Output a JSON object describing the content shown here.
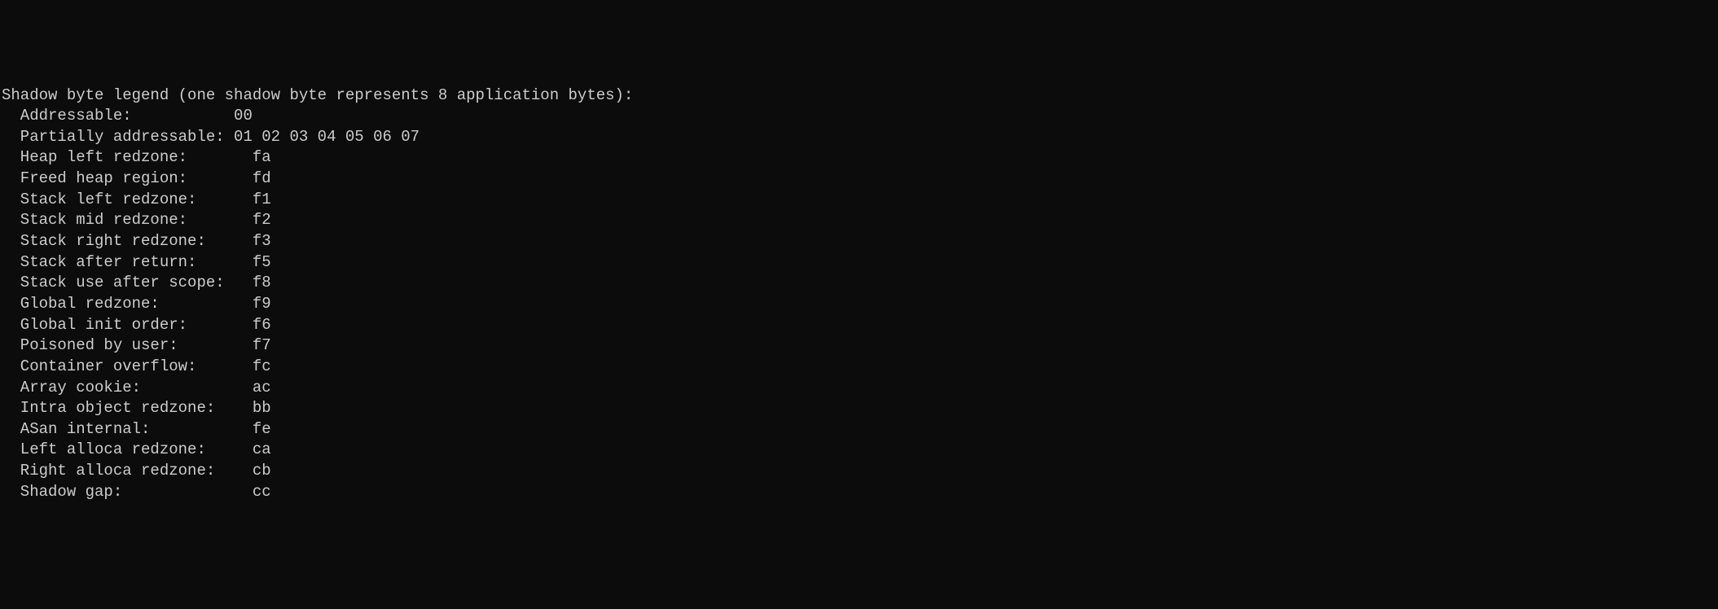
{
  "terminal": {
    "header": "Shadow byte legend (one shadow byte represents 8 application bytes):",
    "entries": [
      {
        "label": "  Addressable:           ",
        "value": "00"
      },
      {
        "label": "  Partially addressable: ",
        "value": "01 02 03 04 05 06 07"
      },
      {
        "label": "  Heap left redzone:       ",
        "value": "fa"
      },
      {
        "label": "  Freed heap region:       ",
        "value": "fd"
      },
      {
        "label": "  Stack left redzone:      ",
        "value": "f1"
      },
      {
        "label": "  Stack mid redzone:       ",
        "value": "f2"
      },
      {
        "label": "  Stack right redzone:     ",
        "value": "f3"
      },
      {
        "label": "  Stack after return:      ",
        "value": "f5"
      },
      {
        "label": "  Stack use after scope:   ",
        "value": "f8"
      },
      {
        "label": "  Global redzone:          ",
        "value": "f9"
      },
      {
        "label": "  Global init order:       ",
        "value": "f6"
      },
      {
        "label": "  Poisoned by user:        ",
        "value": "f7"
      },
      {
        "label": "  Container overflow:      ",
        "value": "fc"
      },
      {
        "label": "  Array cookie:            ",
        "value": "ac"
      },
      {
        "label": "  Intra object redzone:    ",
        "value": "bb"
      },
      {
        "label": "  ASan internal:           ",
        "value": "fe"
      },
      {
        "label": "  Left alloca redzone:     ",
        "value": "ca"
      },
      {
        "label": "  Right alloca redzone:    ",
        "value": "cb"
      },
      {
        "label": "  Shadow gap:              ",
        "value": "cc"
      }
    ]
  }
}
